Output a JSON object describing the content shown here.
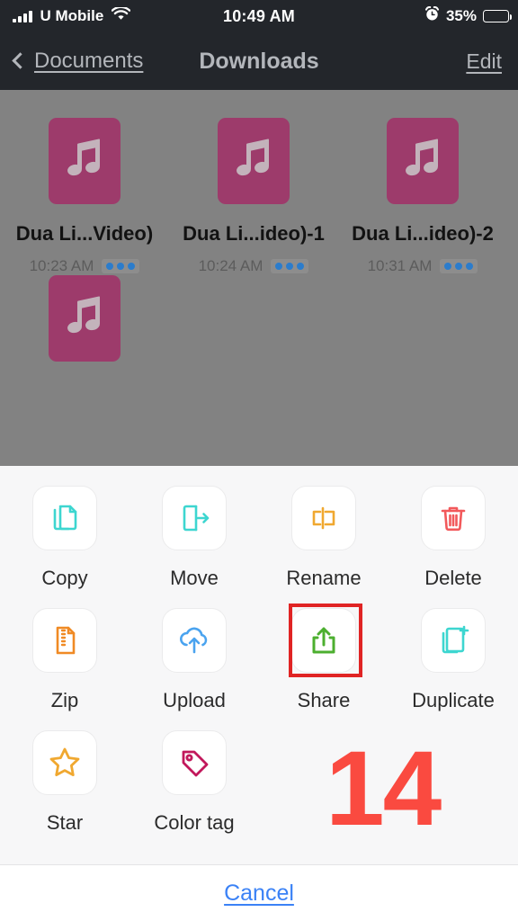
{
  "status_bar": {
    "carrier": "U Mobile",
    "signal_icon": "signal-bars-icon",
    "wifi_icon": "wifi-icon",
    "time": "10:49 AM",
    "alarm_icon": "alarm-clock-icon",
    "battery_percent": "35%",
    "battery_level": 35
  },
  "nav_bar": {
    "back_icon": "chevron-left-icon",
    "back_label": "Documents",
    "title": "Downloads",
    "edit_label": "Edit"
  },
  "files": [
    {
      "icon": "music-file-icon",
      "name": "Dua Li...Video)",
      "time": "10:23 AM",
      "menu_icon": "more-dots-icon"
    },
    {
      "icon": "music-file-icon",
      "name": "Dua Li...ideo)-1",
      "time": "10:24 AM",
      "menu_icon": "more-dots-icon"
    },
    {
      "icon": "music-file-icon",
      "name": "Dua Li...ideo)-2",
      "time": "10:31 AM",
      "menu_icon": "more-dots-icon"
    },
    {
      "icon": "music-file-icon",
      "name": "",
      "time": "",
      "menu_icon": ""
    }
  ],
  "action_sheet": {
    "actions": [
      {
        "label": "Copy",
        "icon": "copy-icon",
        "color": "#3dd6d0"
      },
      {
        "label": "Move",
        "icon": "move-icon",
        "color": "#3dd6d0"
      },
      {
        "label": "Rename",
        "icon": "rename-icon",
        "color": "#f0a830"
      },
      {
        "label": "Delete",
        "icon": "trash-icon",
        "color": "#f2595b"
      },
      {
        "label": "Zip",
        "icon": "zip-icon",
        "color": "#f08a24"
      },
      {
        "label": "Upload",
        "icon": "cloud-upload-icon",
        "color": "#4aa3ef"
      },
      {
        "label": "Share",
        "icon": "share-icon",
        "color": "#4caf2f"
      },
      {
        "label": "Duplicate",
        "icon": "duplicate-icon",
        "color": "#3dd6d0"
      },
      {
        "label": "Star",
        "icon": "star-icon",
        "color": "#f0a830"
      },
      {
        "label": "Color tag",
        "icon": "color-tag-icon",
        "color": "#c2185b"
      }
    ],
    "highlighted_action": "Share",
    "highlight_color": "#e02424",
    "cancel_label": "Cancel"
  },
  "annotation": {
    "step_number": "14",
    "color": "#fa4a40"
  }
}
